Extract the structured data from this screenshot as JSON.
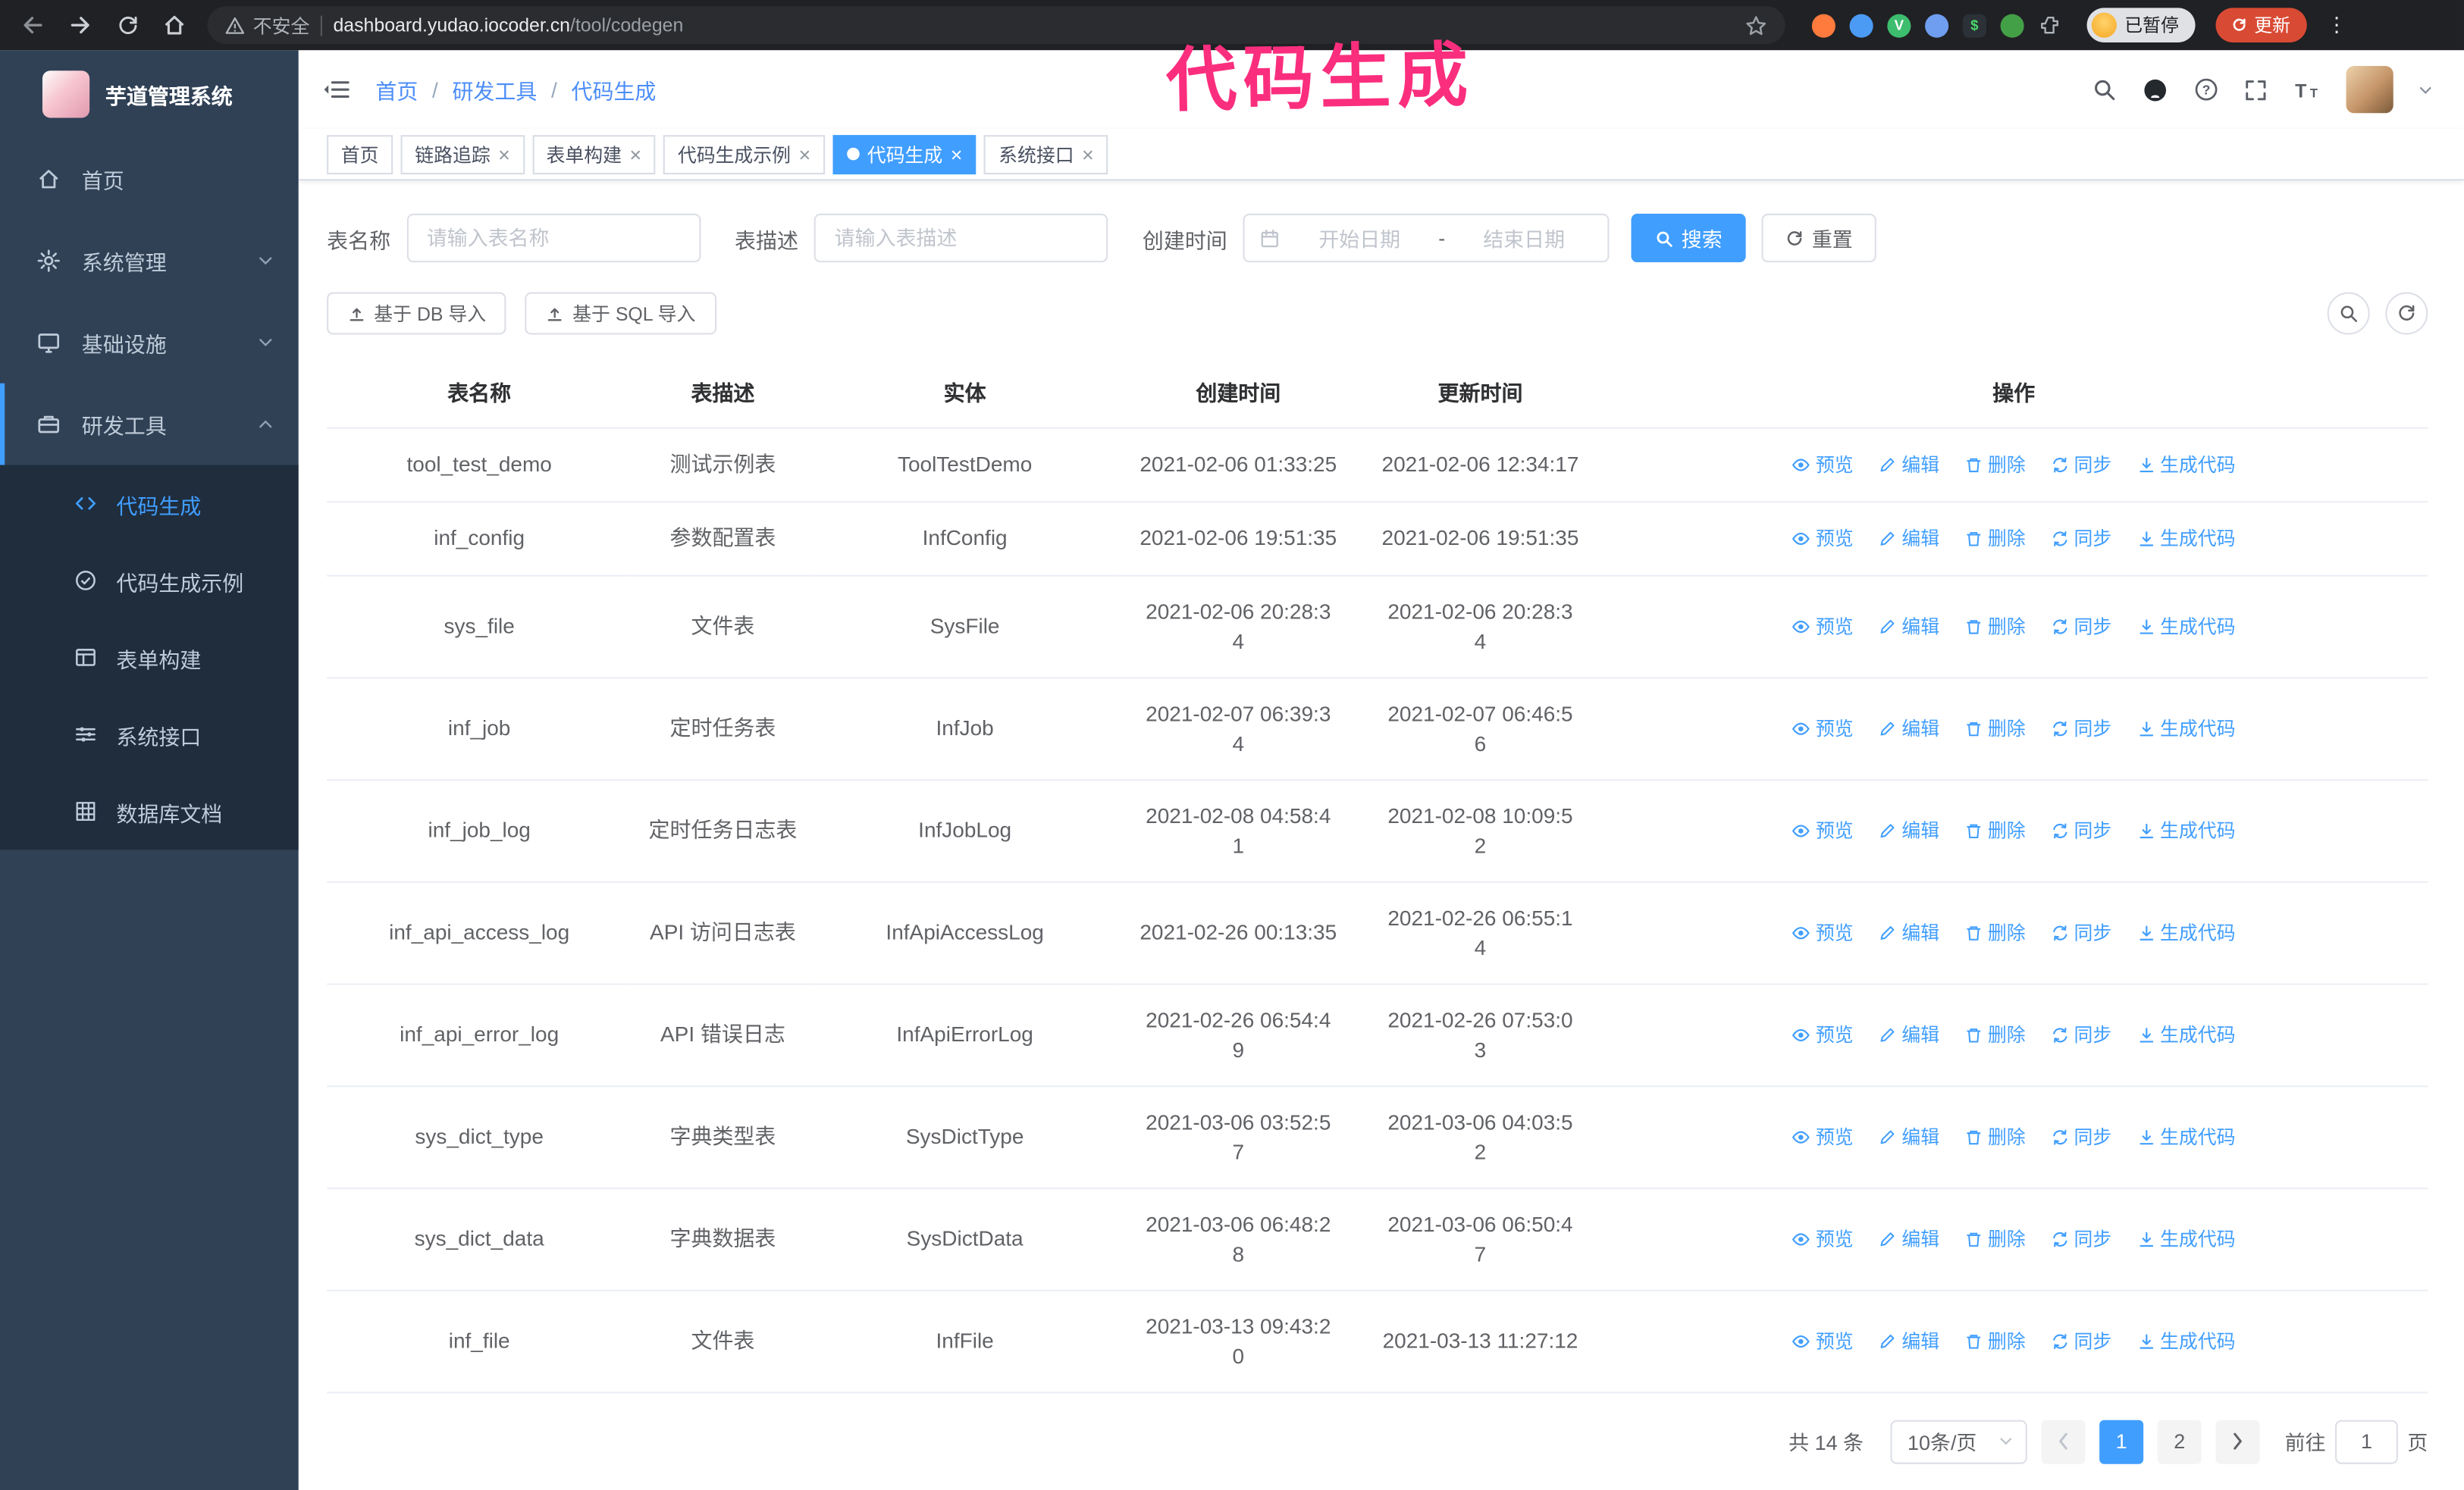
{
  "browser": {
    "security_label": "不安全",
    "url_domain": "dashboard.yudao.iocoder.cn",
    "url_path": "/tool/codegen",
    "profile_chip": "已暂停",
    "update_button": "更新"
  },
  "annotation": "代码生成",
  "sidebar": {
    "logo_title": "芋道管理系统",
    "items": [
      {
        "label": "首页"
      },
      {
        "label": "系统管理"
      },
      {
        "label": "基础设施"
      },
      {
        "label": "研发工具"
      }
    ],
    "submenu": [
      {
        "label": "代码生成"
      },
      {
        "label": "代码生成示例"
      },
      {
        "label": "表单构建"
      },
      {
        "label": "系统接口"
      },
      {
        "label": "数据库文档"
      }
    ]
  },
  "header": {
    "breadcrumb": [
      "首页",
      "研发工具",
      "代码生成"
    ]
  },
  "tabs": [
    {
      "label": "首页",
      "closable": false,
      "active": false
    },
    {
      "label": "链路追踪",
      "closable": true,
      "active": false
    },
    {
      "label": "表单构建",
      "closable": true,
      "active": false
    },
    {
      "label": "代码生成示例",
      "closable": true,
      "active": false
    },
    {
      "label": "代码生成",
      "closable": true,
      "active": true
    },
    {
      "label": "系统接口",
      "closable": true,
      "active": false
    }
  ],
  "filters": {
    "table_name_label": "表名称",
    "table_name_placeholder": "请输入表名称",
    "table_desc_label": "表描述",
    "table_desc_placeholder": "请输入表描述",
    "create_time_label": "创建时间",
    "date_start_placeholder": "开始日期",
    "date_separator": "-",
    "date_end_placeholder": "结束日期",
    "search_button": "搜索",
    "reset_button": "重置"
  },
  "toolbar": {
    "import_db": "基于 DB 导入",
    "import_sql": "基于 SQL 导入"
  },
  "table": {
    "columns": [
      "表名称",
      "表描述",
      "实体",
      "创建时间",
      "更新时间",
      "操作"
    ],
    "action_labels": {
      "preview": "预览",
      "edit": "编辑",
      "delete": "删除",
      "sync": "同步",
      "generate": "生成代码"
    },
    "rows": [
      {
        "name": "tool_test_demo",
        "description": "测试示例表",
        "entity": "ToolTestDemo",
        "create_time": "2021-02-06 01:33:25",
        "update_time": "2021-02-06 12:34:17"
      },
      {
        "name": "inf_config",
        "description": "参数配置表",
        "entity": "InfConfig",
        "create_time": "2021-02-06 19:51:35",
        "update_time": "2021-02-06 19:51:35"
      },
      {
        "name": "sys_file",
        "description": "文件表",
        "entity": "SysFile",
        "create_time": "2021-02-06 20:28:3\n4",
        "update_time": "2021-02-06 20:28:3\n4"
      },
      {
        "name": "inf_job",
        "description": "定时任务表",
        "entity": "InfJob",
        "create_time": "2021-02-07 06:39:3\n4",
        "update_time": "2021-02-07 06:46:5\n6"
      },
      {
        "name": "inf_job_log",
        "description": "定时任务日志表",
        "entity": "InfJobLog",
        "create_time": "2021-02-08 04:58:4\n1",
        "update_time": "2021-02-08 10:09:5\n2"
      },
      {
        "name": "inf_api_access_log",
        "description": "API 访问日志表",
        "entity": "InfApiAccessLog",
        "create_time": "2021-02-26 00:13:35",
        "update_time": "2021-02-26 06:55:1\n4"
      },
      {
        "name": "inf_api_error_log",
        "description": "API 错误日志",
        "entity": "InfApiErrorLog",
        "create_time": "2021-02-26 06:54:4\n9",
        "update_time": "2021-02-26 07:53:0\n3"
      },
      {
        "name": "sys_dict_type",
        "description": "字典类型表",
        "entity": "SysDictType",
        "create_time": "2021-03-06 03:52:5\n7",
        "update_time": "2021-03-06 04:03:5\n2"
      },
      {
        "name": "sys_dict_data",
        "description": "字典数据表",
        "entity": "SysDictData",
        "create_time": "2021-03-06 06:48:2\n8",
        "update_time": "2021-03-06 06:50:4\n7"
      },
      {
        "name": "inf_file",
        "description": "文件表",
        "entity": "InfFile",
        "create_time": "2021-03-13 09:43:2\n0",
        "update_time": "2021-03-13 11:27:12"
      }
    ]
  },
  "pagination": {
    "total": "共 14 条",
    "page_size": "10条/页",
    "pages": [
      "1",
      "2"
    ],
    "goto_label": "前往",
    "goto_value": "1",
    "goto_unit": "页"
  },
  "colors": {
    "accent": "#409EFF",
    "sidebar_bg": "#304156",
    "submenu_bg": "#1F2D3D",
    "annotation": "#FB2E7E",
    "chrome_bg": "#202124",
    "update_button": "#D94A34"
  }
}
